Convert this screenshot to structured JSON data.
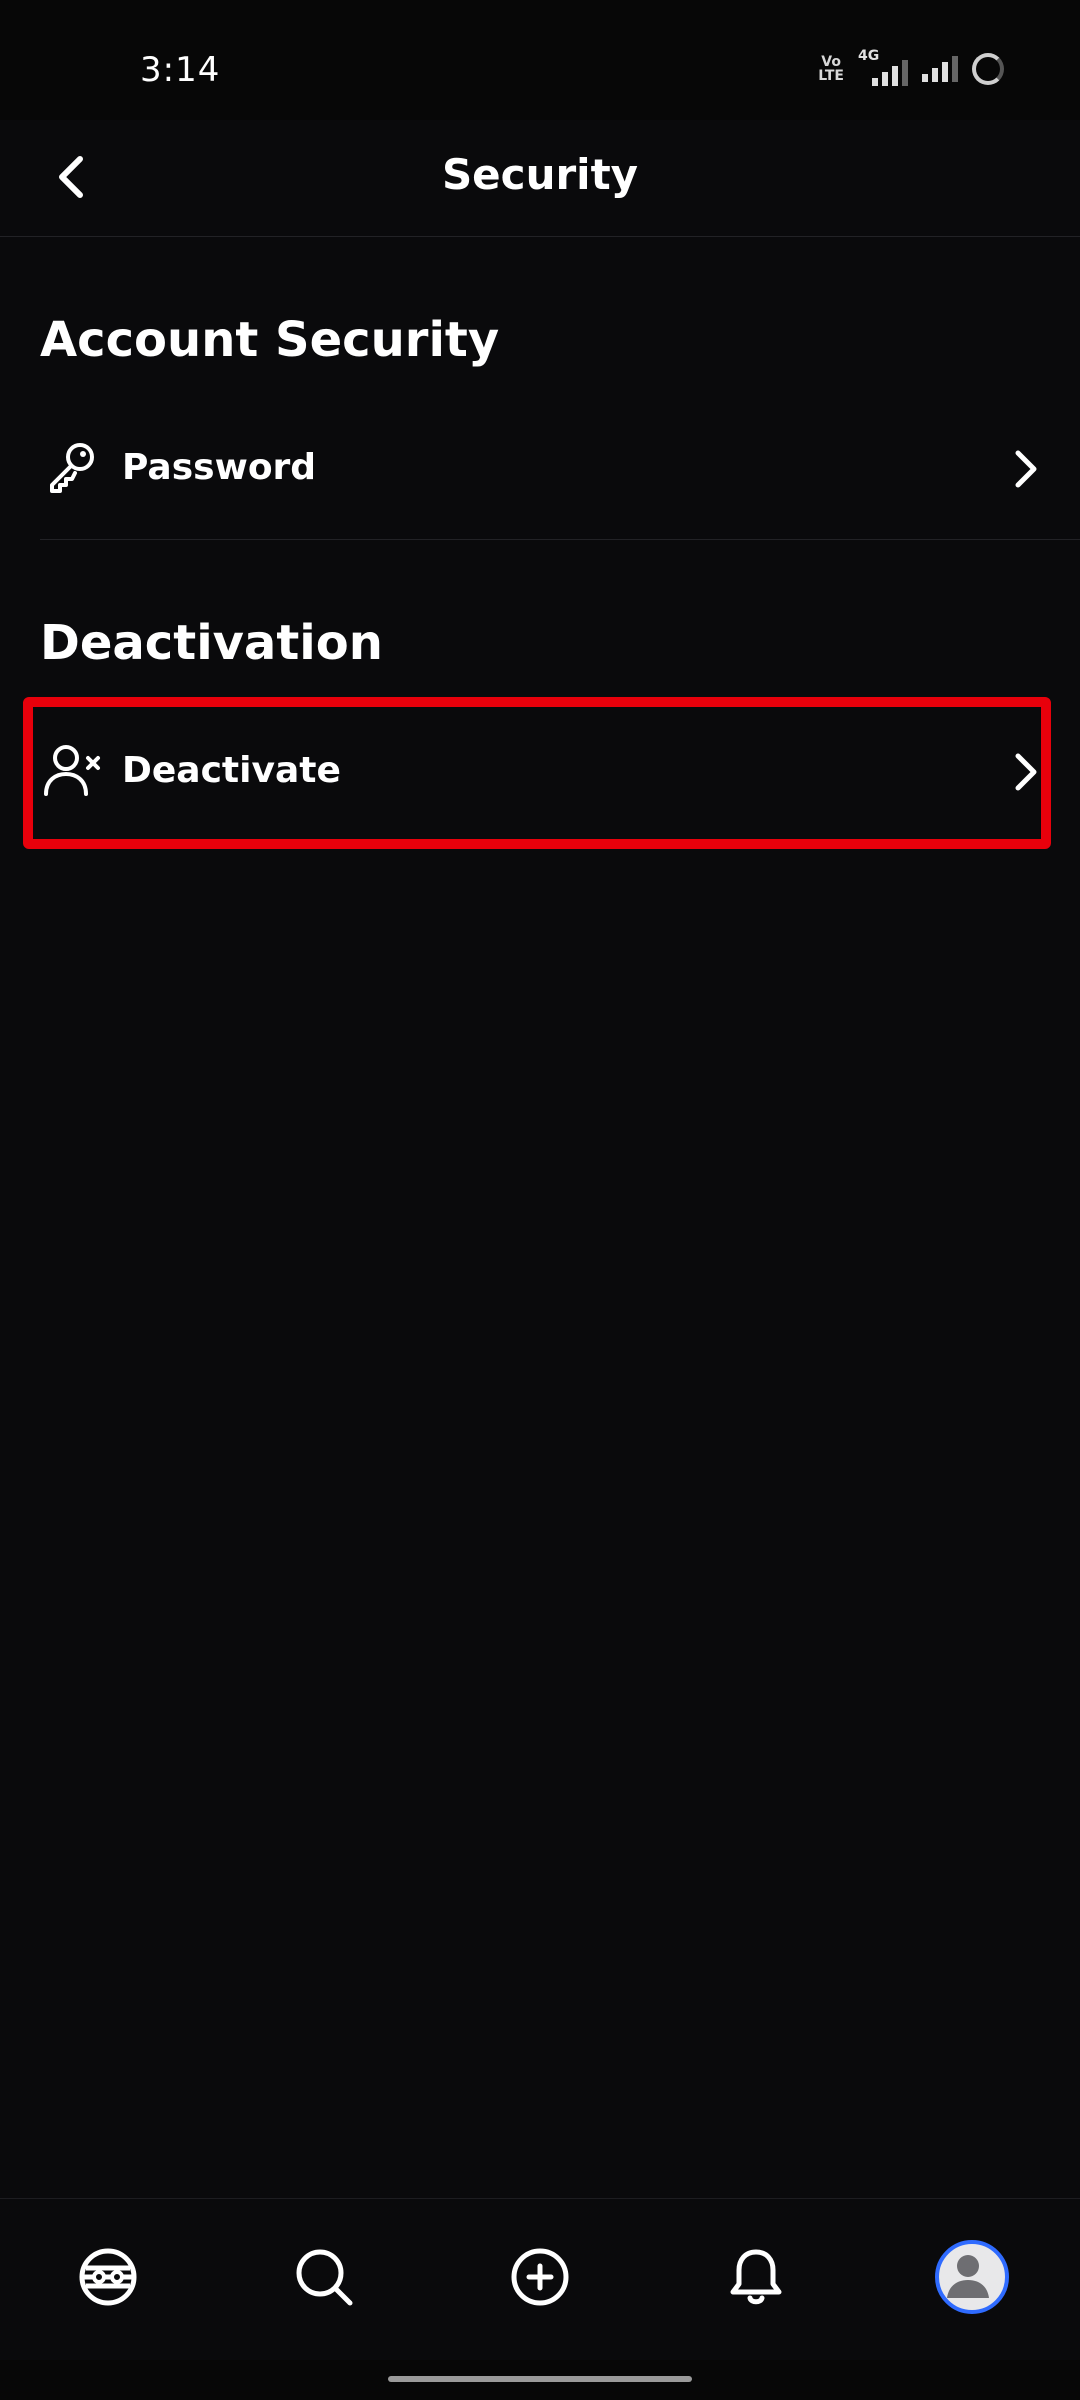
{
  "status_bar": {
    "time": "3:14",
    "volte_line1": "Vo",
    "volte_line2": "LTE",
    "network_label": "4G"
  },
  "header": {
    "title": "Security",
    "back_icon": "chevron-left-icon"
  },
  "sections": {
    "account_security": {
      "title": "Account Security",
      "items": [
        {
          "label": "Password",
          "icon": "key-icon"
        }
      ]
    },
    "deactivation": {
      "title": "Deactivation",
      "items": [
        {
          "label": "Deactivate",
          "icon": "user-remove-icon"
        }
      ]
    }
  },
  "bottom_nav": {
    "items": [
      {
        "icon": "home-logo-icon"
      },
      {
        "icon": "search-icon"
      },
      {
        "icon": "add-circle-icon"
      },
      {
        "icon": "bell-icon"
      },
      {
        "icon": "profile-avatar-icon"
      }
    ]
  },
  "colors": {
    "background": "#0a0a0c",
    "highlight": "#e8000b",
    "avatar_ring": "#2f6bff"
  }
}
